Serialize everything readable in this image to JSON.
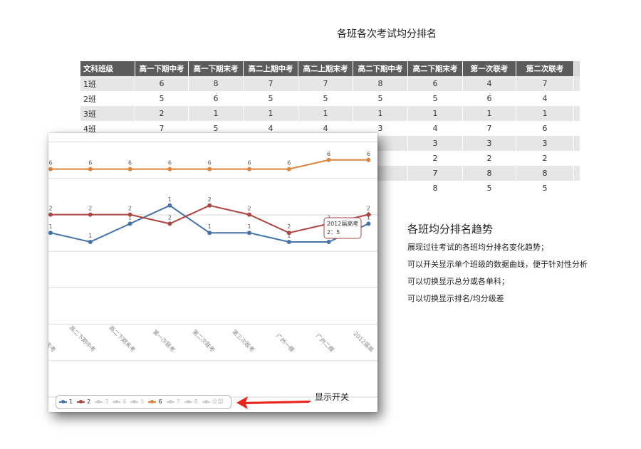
{
  "page_title": "各班各次考试均分排名",
  "table": {
    "headers": [
      "文科班级",
      "高一下期中考",
      "高一下期末考",
      "高二上期中考",
      "高二上期末考",
      "高二下期中考",
      "高二下期末考",
      "第一次联考",
      "第二次联考"
    ],
    "rows": [
      [
        "1班",
        "6",
        "8",
        "7",
        "7",
        "8",
        "6",
        "4",
        "7"
      ],
      [
        "2班",
        "5",
        "6",
        "5",
        "5",
        "5",
        "5",
        "6",
        "4"
      ],
      [
        "3班",
        "2",
        "1",
        "1",
        "1",
        "1",
        "1",
        "1",
        "1"
      ],
      [
        "4班",
        "7",
        "5",
        "4",
        "4",
        "3",
        "4",
        "7",
        "6"
      ],
      [
        "",
        "",
        "",
        "",
        "",
        "",
        "3",
        "3",
        "3"
      ],
      [
        "",
        "",
        "",
        "",
        "",
        "",
        "2",
        "2",
        "2"
      ],
      [
        "",
        "",
        "",
        "",
        "",
        "",
        "7",
        "8",
        "8"
      ],
      [
        "",
        "",
        "",
        "",
        "",
        "",
        "8",
        "5",
        "5"
      ]
    ]
  },
  "chart_data": {
    "type": "line",
    "categories": [
      "高一下期末考",
      "高二上期中考",
      "高二上期末考",
      "第一次联考",
      "第二次联考",
      "第三次联考",
      "广州一模",
      "广州二模",
      "2012届高考"
    ],
    "category_labels_visible": [
      "上期末考",
      "高二下期中考",
      "高二下期末考",
      "第一次联考",
      "第二次联考",
      "第三次联考",
      "广州一模",
      "广州二模",
      "2012届高"
    ],
    "series": [
      {
        "name": "1",
        "color": "#4572a7",
        "values": [
          1,
          1,
          1,
          1,
          1,
          1,
          1,
          1,
          1
        ],
        "levels": [
          4.5,
          5,
          4,
          3,
          4.5,
          4.5,
          5,
          5,
          4
        ]
      },
      {
        "name": "2",
        "color": "#aa4643",
        "values": [
          2,
          2,
          2,
          2,
          2,
          2,
          2,
          2,
          2
        ],
        "levels": [
          3.5,
          3.5,
          3.5,
          4,
          3,
          3.5,
          4.5,
          4,
          3.5
        ]
      },
      {
        "name": "6",
        "color": "#db843d",
        "values": [
          6,
          6,
          6,
          6,
          6,
          6,
          6,
          6,
          6
        ],
        "levels": [
          1,
          1,
          1,
          1,
          1,
          1,
          1,
          0.5,
          0.5
        ]
      }
    ],
    "tooltip": {
      "title": "2012届高考",
      "text": "2：5"
    },
    "legend": [
      {
        "label": "1",
        "color": "#4572a7",
        "active": true
      },
      {
        "label": "2",
        "color": "#aa4643",
        "active": true
      },
      {
        "label": "3",
        "color": "#cccccc",
        "active": false
      },
      {
        "label": "4",
        "color": "#cccccc",
        "active": false
      },
      {
        "label": "5",
        "color": "#cccccc",
        "active": false
      },
      {
        "label": "6",
        "color": "#db843d",
        "active": true
      },
      {
        "label": "7",
        "color": "#cccccc",
        "active": false
      },
      {
        "label": "8",
        "color": "#cccccc",
        "active": false
      },
      {
        "label": "全部",
        "color": "#cccccc",
        "active": false
      }
    ]
  },
  "annotation": {
    "legend_note": "显示开关"
  },
  "description": {
    "title": "各班均分排名趋势",
    "lines": [
      "展现过往考试的各班均分排名变化趋势；",
      "可以开关显示单个班级的数据曲线，便于针对性分析",
      "可以切换显示总分或各单科；",
      "可以切换显示排名/均分级差"
    ]
  }
}
